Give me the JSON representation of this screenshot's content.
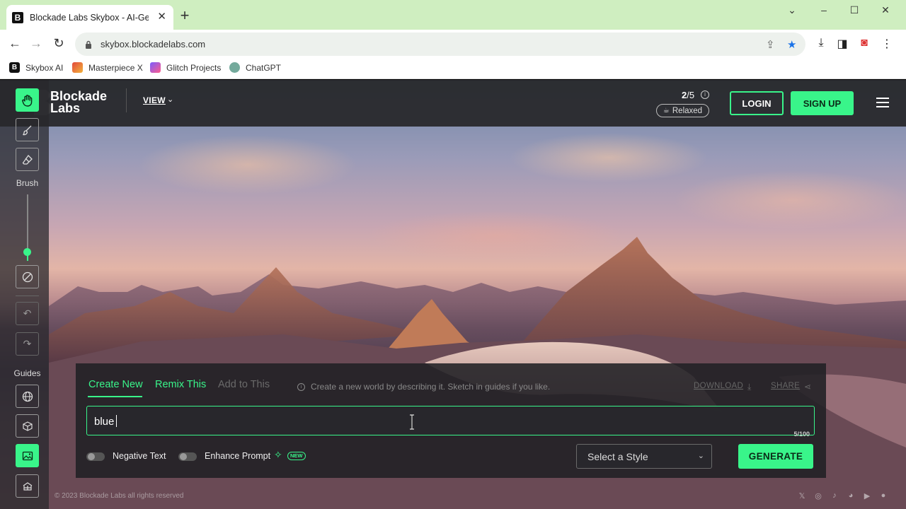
{
  "browser": {
    "tab_title": "Blockade Labs Skybox - AI-Gene",
    "tab_favicon": "B",
    "url": "skybox.blockadelabs.com",
    "bookmarks": [
      {
        "label": "Skybox AI",
        "icon": "B",
        "color": "#111111"
      },
      {
        "label": "Masterpiece X",
        "icon": "",
        "color": "#e2483c"
      },
      {
        "label": "Glitch Projects",
        "icon": "",
        "color": "#7a5cff"
      },
      {
        "label": "ChatGPT",
        "icon": "",
        "color": "#74aa9c"
      }
    ]
  },
  "header": {
    "logo_line1": "Blockade",
    "logo_line2": "Labs",
    "view_label": "VIEW",
    "quota_used": "2",
    "quota_total": "/5",
    "mode_label": "Relaxed",
    "login_label": "LOGIN",
    "signup_label": "SIGN UP"
  },
  "toolbar": {
    "brush_label": "Brush",
    "guides_label": "Guides",
    "brush_size": 0.15,
    "accent": "#39f58a"
  },
  "panel": {
    "tabs": [
      {
        "label": "Create New",
        "state": "active",
        "color": "#39f58a"
      },
      {
        "label": "Remix This",
        "state": "enabled",
        "color": "#39f58a"
      },
      {
        "label": "Add to This",
        "state": "disabled",
        "color": "#6a6a6a"
      }
    ],
    "hint": "Create a new world by describing it. Sketch in guides if you like.",
    "download_label": "DOWNLOAD",
    "share_label": "SHARE",
    "prompt_value": "blue",
    "prompt_counter": "5/100",
    "negative_text_label": "Negative Text",
    "enhance_prompt_label": "Enhance Prompt",
    "new_badge": "NEW",
    "style_placeholder": "Select a Style",
    "generate_label": "GENERATE"
  },
  "footer": {
    "copyright": "© 2023 Blockade Labs all rights reserved"
  }
}
